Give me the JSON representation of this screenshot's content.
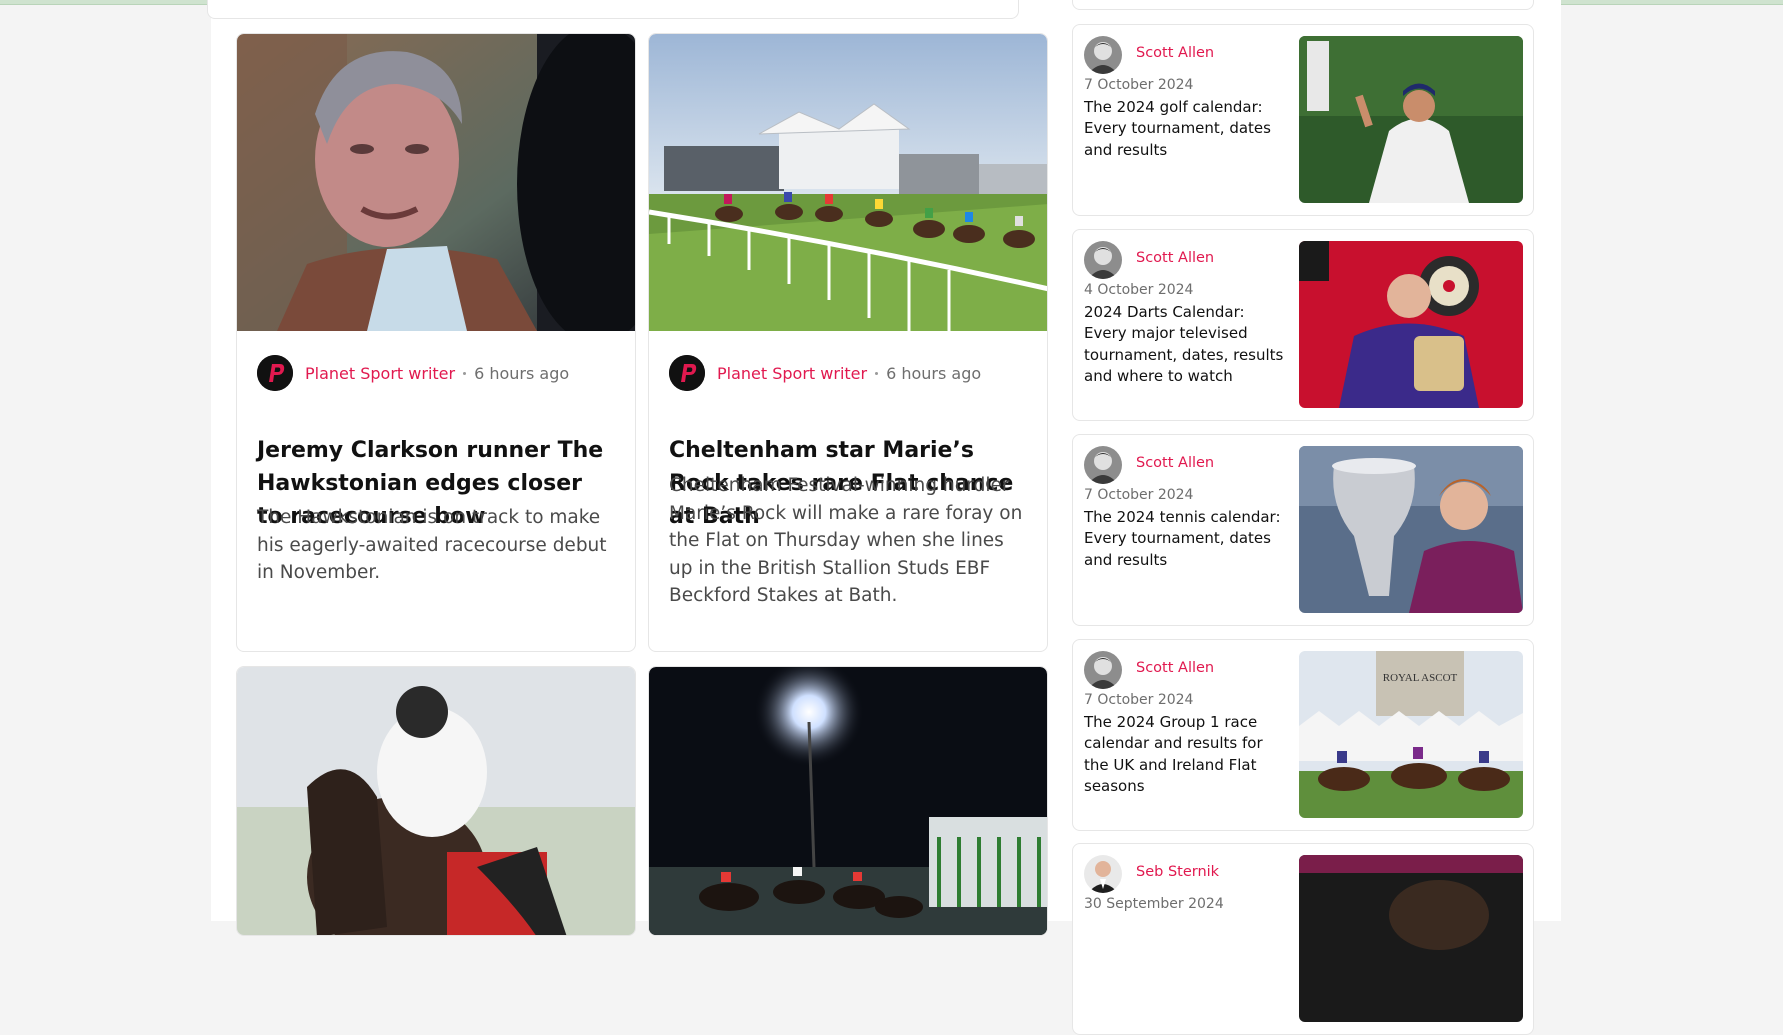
{
  "articles": [
    {
      "author": "Planet Sport writer",
      "time": "6 hours ago",
      "title": "Jeremy Clarkson runner The Hawkstonian edges closer to racecourse bow",
      "description": "The Hawkstonian is on track to make his eagerly-awaited racecourse debut in November."
    },
    {
      "author": "Planet Sport writer",
      "time": "6 hours ago",
      "title": "Cheltenham star Marie’s Rock takes rare Flat chance at Bath",
      "description": "Cheltenham Festival-winning hurdler Marie’s Rock will make a rare foray on the Flat on Thursday when she lines up in the British Stallion Studs EBF Beckford Stakes at Bath."
    }
  ],
  "sidebar": [
    {
      "author": "Scott Allen",
      "date": "7 October 2024",
      "title": "The 2024 golf calendar: Every tournament, dates and results"
    },
    {
      "author": "Scott Allen",
      "date": "4 October 2024",
      "title": "2024 Darts Calendar: Every major televised tournament, dates, results and where to watch"
    },
    {
      "author": "Scott Allen",
      "date": "7 October 2024",
      "title": "The 2024 tennis calendar: Every tournament, dates and results"
    },
    {
      "author": "Scott Allen",
      "date": "7 October 2024",
      "title": "The 2024 Group 1 race calendar and results for the UK and Ireland Flat seasons"
    },
    {
      "author": "Seb Sternik",
      "date": "30 September 2024",
      "title": ""
    }
  ],
  "images": {
    "royal_ascot_sign": "ROYAL ASCOT"
  },
  "colors": {
    "accent": "#e1194f",
    "background": "#f4f4f4"
  },
  "icons": {
    "brand_logo": "planet-sport-logo"
  }
}
